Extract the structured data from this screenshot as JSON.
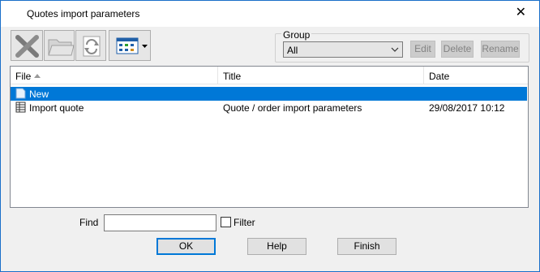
{
  "window": {
    "title": "Quotes import parameters",
    "close_glyph": "✕"
  },
  "toolbar": {
    "icons": [
      "delete-x-icon",
      "folder-icon",
      "refresh-icon",
      "view-mode-icon"
    ]
  },
  "group": {
    "label": "Group",
    "selected": "All",
    "edit_label": "Edit",
    "delete_label": "Delete",
    "rename_label": "Rename"
  },
  "list": {
    "columns": {
      "file": "File",
      "title": "Title",
      "date": "Date"
    },
    "rows": [
      {
        "file": "New",
        "title": "",
        "date": "",
        "selected": true
      },
      {
        "file": "Import quote",
        "title": "Quote / order import parameters",
        "date": "29/08/2017  10:12",
        "selected": false
      }
    ]
  },
  "find": {
    "label": "Find",
    "value": "",
    "filter_label": "Filter"
  },
  "buttons": {
    "ok": "OK",
    "help": "Help",
    "finish": "Finish"
  },
  "colors": {
    "selection": "#0078d7",
    "window_border": "#1a6fc9"
  }
}
